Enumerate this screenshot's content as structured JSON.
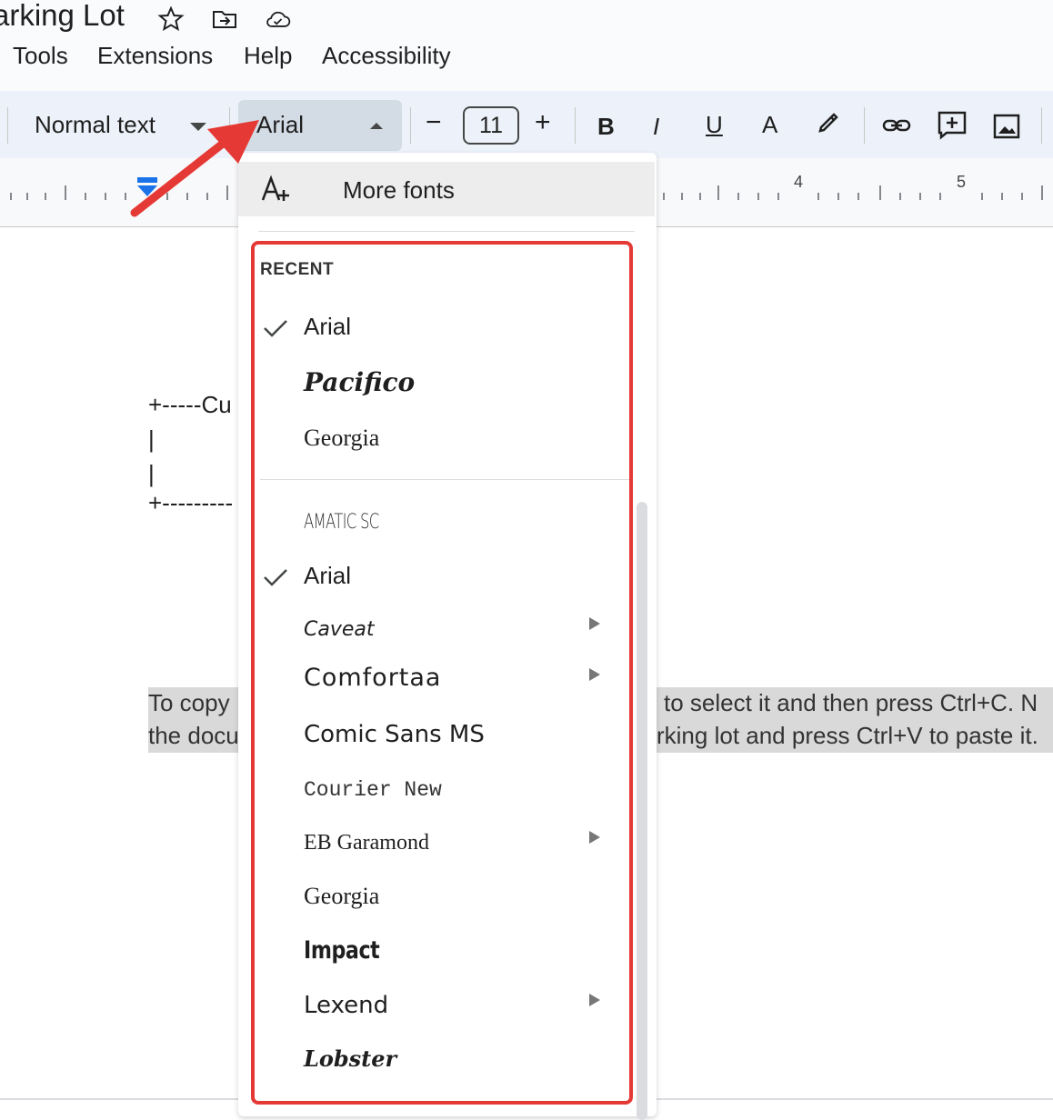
{
  "window": {
    "doc_title": "arking Lot"
  },
  "menu": [
    "Tools",
    "Extensions",
    "Help",
    "Accessibility"
  ],
  "toolbar": {
    "style_label": "Normal text",
    "font_label": "Arial",
    "font_size": "11",
    "minus": "−",
    "plus": "+",
    "bold": "B",
    "italic": "I",
    "underline": "U",
    "text_color": "A"
  },
  "ruler": {
    "label_4": "4",
    "label_5": "5"
  },
  "document": {
    "box_line1": "+-----Cu",
    "box_line2": "|",
    "box_line3": "|",
    "box_line4": "+---------",
    "para_left_1": "To copy",
    "para_left_2": "the docu",
    "para_right_1": "to select it and then press Ctrl+C. N",
    "para_right_2": "rking lot and press Ctrl+V to paste it."
  },
  "dropdown": {
    "more_fonts": "More fonts",
    "recent_label": "RECENT",
    "recent": [
      {
        "name": "Arial",
        "checked": true
      },
      {
        "name": "Pacifico",
        "checked": false
      },
      {
        "name": "Georgia",
        "checked": false
      }
    ],
    "all": [
      {
        "name": "Amatic SC",
        "checked": false,
        "submenu": false
      },
      {
        "name": "Arial",
        "checked": true,
        "submenu": false
      },
      {
        "name": "Caveat",
        "checked": false,
        "submenu": true
      },
      {
        "name": "Comfortaa",
        "checked": false,
        "submenu": true
      },
      {
        "name": "Comic Sans MS",
        "checked": false,
        "submenu": false
      },
      {
        "name": "Courier New",
        "checked": false,
        "submenu": false
      },
      {
        "name": "EB Garamond",
        "checked": false,
        "submenu": true
      },
      {
        "name": "Georgia",
        "checked": false,
        "submenu": false
      },
      {
        "name": "Impact",
        "checked": false,
        "submenu": false
      },
      {
        "name": "Lexend",
        "checked": false,
        "submenu": true
      },
      {
        "name": "Lobster",
        "checked": false,
        "submenu": false
      }
    ]
  },
  "colors": {
    "accent_red": "#e53935",
    "ruler_marker": "#1a73e8",
    "toolbar_bg": "#edf2fa"
  }
}
